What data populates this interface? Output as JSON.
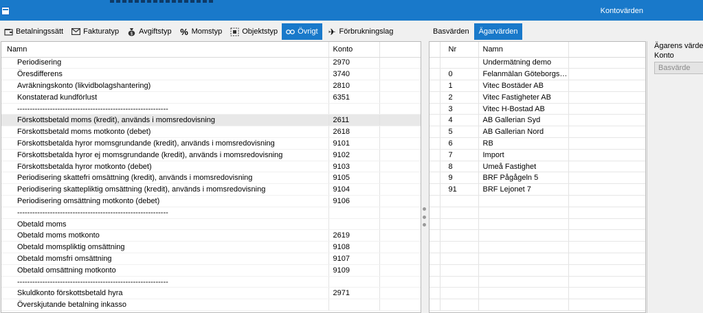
{
  "window": {
    "right_title": "Kontovärden"
  },
  "left_tabs": [
    {
      "label": "Betalningssätt",
      "icon": "wallet-icon"
    },
    {
      "label": "Fakturatyp",
      "icon": "envelope-icon"
    },
    {
      "label": "Avgiftstyp",
      "icon": "money-bag-icon"
    },
    {
      "label": "Momstyp",
      "icon": "percent-icon"
    },
    {
      "label": "Objektstyp",
      "icon": "object-frame-icon"
    },
    {
      "label": "Övrigt",
      "icon": "glasses-icon",
      "active": true
    },
    {
      "label": "Förbrukningslag",
      "icon": "airplane-icon"
    }
  ],
  "right_tabs": [
    {
      "label": "Basvärden",
      "active": false
    },
    {
      "label": "Ägarvärden",
      "active": true
    }
  ],
  "left_table": {
    "headers": {
      "name": "Namn",
      "konto": "Konto"
    },
    "rows": [
      {
        "name": "Periodisering",
        "konto": "2970"
      },
      {
        "name": "Öresdifferens",
        "konto": "3740"
      },
      {
        "name": "Avräkningskonto (likvidbolagshantering)",
        "konto": "2810"
      },
      {
        "name": "Konstaterad kundförlust",
        "konto": "6351"
      },
      {
        "name": "------------------------------------------------------------",
        "konto": ""
      },
      {
        "name": "Förskottsbetald moms (kredit), används i momsredovisning",
        "konto": "2611",
        "selected": true
      },
      {
        "name": "Förskottsbetald moms motkonto (debet)",
        "konto": "2618"
      },
      {
        "name": "Förskottsbetalda hyror momsgrundande (kredit), används i momsredovisning",
        "konto": "9101"
      },
      {
        "name": "Förskottsbetalda hyror ej momsgrundande (kredit), används i momsredovisning",
        "konto": "9102"
      },
      {
        "name": "Förskottsbetalda hyror motkonto (debet)",
        "konto": "9103"
      },
      {
        "name": "Periodisering skattefri omsättning (kredit), används i momsredovisning",
        "konto": "9105"
      },
      {
        "name": "Periodisering skattepliktig omsättning (kredit), används i momsredovisning",
        "konto": "9104"
      },
      {
        "name": "Periodisering omsättning motkonto (debet)",
        "konto": "9106"
      },
      {
        "name": "------------------------------------------------------------",
        "konto": ""
      },
      {
        "name": "Obetald moms",
        "konto": ""
      },
      {
        "name": "Obetald moms motkonto",
        "konto": "2619"
      },
      {
        "name": "Obetald momspliktig omsättning",
        "konto": "9108"
      },
      {
        "name": "Obetald momsfri omsättning",
        "konto": "9107"
      },
      {
        "name": "Obetald omsättning motkonto",
        "konto": "9109"
      },
      {
        "name": "------------------------------------------------------------",
        "konto": ""
      },
      {
        "name": "Skuldkonto förskottsbetald hyra",
        "konto": "2971"
      },
      {
        "name": "Överskjutande betalning inkasso",
        "konto": ""
      }
    ]
  },
  "right_table": {
    "headers": {
      "nr": "Nr",
      "namn": "Namn"
    },
    "rows": [
      {
        "nr": "",
        "namn": "Undermätning demo"
      },
      {
        "nr": "0",
        "namn": "Felanmälan Göteborgs ..."
      },
      {
        "nr": "1",
        "namn": "Vitec Bostäder AB"
      },
      {
        "nr": "2",
        "namn": "Vitec Fastigheter AB"
      },
      {
        "nr": "3",
        "namn": "Vitec H-Bostad AB"
      },
      {
        "nr": "4",
        "namn": "AB Gallerian Syd"
      },
      {
        "nr": "5",
        "namn": "AB Gallerian Nord"
      },
      {
        "nr": "6",
        "namn": "RB"
      },
      {
        "nr": "7",
        "namn": "Import"
      },
      {
        "nr": "8",
        "namn": "Umeå Fastighet"
      },
      {
        "nr": "9",
        "namn": "BRF Pågågeln 5"
      },
      {
        "nr": "91",
        "namn": "BRF Lejonet 7"
      }
    ]
  },
  "side_props": {
    "label_line1": "Ägarens värde",
    "label_line2": "Konto",
    "field_value": "Basvärde"
  },
  "colors": {
    "accent": "#1979ca"
  }
}
